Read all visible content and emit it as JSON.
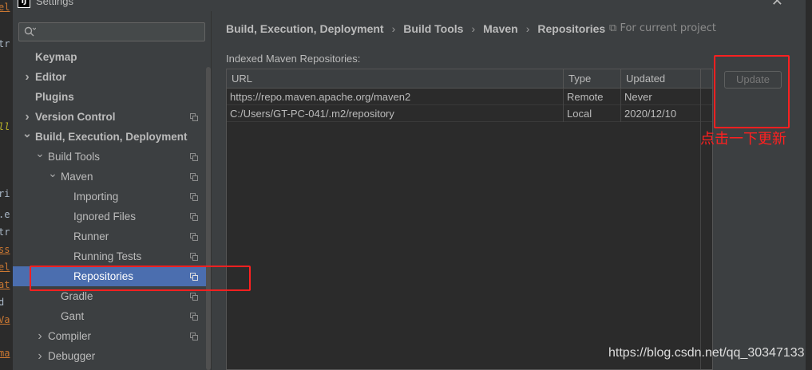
{
  "window": {
    "title": "Settings",
    "app_icon_text": "IJ",
    "close_icon": "close-icon"
  },
  "background_editor": {
    "fragments": [
      "el",
      "tr",
      "ll",
      "ri",
      ".e",
      "tr",
      "ss",
      "el",
      "at",
      "d",
      "Va",
      "ma"
    ]
  },
  "sidebar": {
    "search": {
      "value": "",
      "placeholder": ""
    },
    "items": [
      {
        "label": "Keymap",
        "level": 0,
        "bold": true,
        "expander": "",
        "copy_icon": false
      },
      {
        "label": "Editor",
        "level": 0,
        "bold": true,
        "expander": "collapsed",
        "copy_icon": false
      },
      {
        "label": "Plugins",
        "level": 0,
        "bold": true,
        "expander": "",
        "copy_icon": false
      },
      {
        "label": "Version Control",
        "level": 0,
        "bold": true,
        "expander": "collapsed",
        "copy_icon": true
      },
      {
        "label": "Build, Execution, Deployment",
        "level": 0,
        "bold": true,
        "expander": "expanded",
        "copy_icon": false
      },
      {
        "label": "Build Tools",
        "level": 1,
        "bold": false,
        "expander": "expanded",
        "copy_icon": true
      },
      {
        "label": "Maven",
        "level": 2,
        "bold": false,
        "expander": "expanded",
        "copy_icon": true
      },
      {
        "label": "Importing",
        "level": 3,
        "bold": false,
        "expander": "",
        "copy_icon": true
      },
      {
        "label": "Ignored Files",
        "level": 3,
        "bold": false,
        "expander": "",
        "copy_icon": true
      },
      {
        "label": "Runner",
        "level": 3,
        "bold": false,
        "expander": "",
        "copy_icon": true
      },
      {
        "label": "Running Tests",
        "level": 3,
        "bold": false,
        "expander": "",
        "copy_icon": true
      },
      {
        "label": "Repositories",
        "level": 3,
        "bold": false,
        "expander": "",
        "copy_icon": true,
        "selected": true
      },
      {
        "label": "Gradle",
        "level": 2,
        "bold": false,
        "expander": "",
        "copy_icon": true
      },
      {
        "label": "Gant",
        "level": 2,
        "bold": false,
        "expander": "",
        "copy_icon": true
      },
      {
        "label": "Compiler",
        "level": 1,
        "bold": false,
        "expander": "collapsed",
        "copy_icon": true
      },
      {
        "label": "Debugger",
        "level": 1,
        "bold": false,
        "expander": "collapsed",
        "copy_icon": false
      }
    ]
  },
  "main": {
    "breadcrumb": [
      "Build, Execution, Deployment",
      "Build Tools",
      "Maven",
      "Repositories"
    ],
    "scope_note": "For current project",
    "section_label": "Indexed Maven Repositories:",
    "table": {
      "columns": [
        "URL",
        "Type",
        "Updated"
      ],
      "rows": [
        [
          "https://repo.maven.apache.org/maven2",
          "Remote",
          "Never"
        ],
        [
          "C:/Users/GT-PC-041/.m2/repository",
          "Local",
          "2020/12/10"
        ]
      ]
    },
    "update_button_label": "Update",
    "update_button_enabled": false
  },
  "annotations": {
    "note": "点击一下更新",
    "color": "#ff2020"
  },
  "watermark": "https://blog.csdn.net/qq_30347133",
  "colors": {
    "selection": "#4b6eaf",
    "panel_bg": "#3c3f41",
    "table_bg": "#2b2b2b",
    "text": "#bbbbbb"
  }
}
